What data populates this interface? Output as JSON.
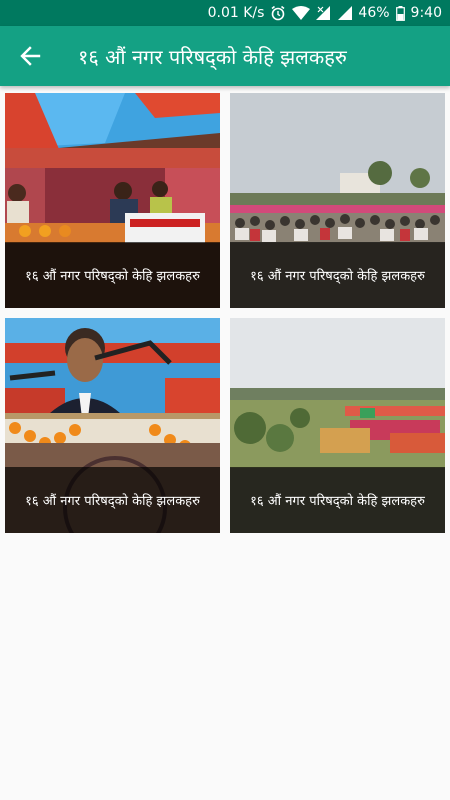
{
  "status_bar": {
    "speed": "0.01 K/s",
    "battery": "46%",
    "time": "9:40",
    "icons": [
      "alarm-icon",
      "wifi-icon",
      "signal-icon",
      "battery-icon"
    ]
  },
  "app_bar": {
    "title": "१६ औं नगर परिषद्को केहि झलकहरु",
    "back_icon": "arrow-back-icon",
    "color": "#14a184"
  },
  "gallery": {
    "items": [
      {
        "caption": "१६ औं नगर परिषद्को केहि झलकहरु",
        "image": "stage-with-officials-photo"
      },
      {
        "caption": "१६ औं नगर परिषद्को केहि झलकहरु",
        "image": "crowd-audience-photo"
      },
      {
        "caption": "१६ औं नगर परिषद्को केहि झलकहरु",
        "image": "speaker-at-podium-photo"
      },
      {
        "caption": "१६ औं नगर परिषद्को केहि झलकहरु",
        "image": "field-overview-photo"
      }
    ]
  }
}
